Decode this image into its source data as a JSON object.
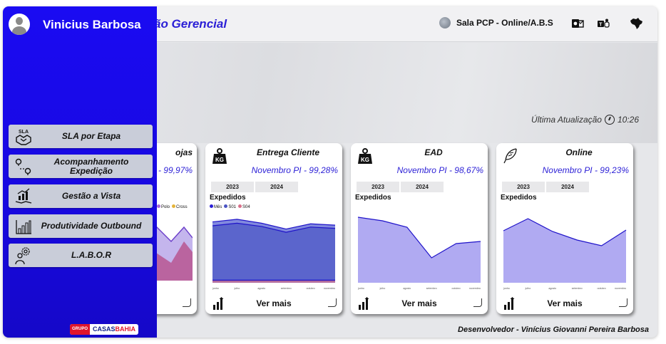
{
  "header": {
    "title": "ão Gerencial",
    "status": "Sala PCP - Online/A.B.S",
    "icons": [
      "brain-icon",
      "outlook-icon",
      "teams-icon",
      "brazil-map-icon"
    ]
  },
  "last_update": {
    "label": "Última Atualização",
    "time": "10:26"
  },
  "sidebar": {
    "user": "Vinicius Barbosa",
    "items": [
      {
        "label": "SLA por Etapa",
        "icon": "sla-handshake-icon"
      },
      {
        "label": "Acompanhamento Expedição",
        "icon": "route-pin-icon"
      },
      {
        "label": "Gestão a Vista",
        "icon": "growth-hands-icon"
      },
      {
        "label": "Produtividade Outbound",
        "icon": "bar-chart-icon"
      },
      {
        "label": "L.A.B.O.R",
        "icon": "worker-gear-icon"
      }
    ],
    "brand": {
      "grupo": "GRUPO",
      "casas": "CASAS",
      "bahia": "BAHIA"
    }
  },
  "cards": [
    {
      "title": "ojas",
      "month_text": "- 99,97%",
      "legend": [
        "Polo",
        "Cross"
      ],
      "more": ""
    },
    {
      "title": "Entrega Cliente",
      "month_text": "Novembro PI - 99,28%",
      "years": [
        "2023",
        "2024"
      ],
      "subtitle": "Expedidos",
      "legend": [
        "Mês",
        "S01",
        "S04"
      ],
      "more": "Ver mais"
    },
    {
      "title": "EAD",
      "month_text": "Novembro PI - 98,67%",
      "years": [
        "2023",
        "2024"
      ],
      "subtitle": "Expedidos",
      "more": "Ver mais"
    },
    {
      "title": "Online",
      "month_text": "Novembro PI - 99,23%",
      "years": [
        "2023",
        "2024"
      ],
      "subtitle": "Expedidos",
      "more": "Ver mais"
    }
  ],
  "chart_data": [
    {
      "type": "area",
      "title": "Expedidos",
      "categories": [
        "junho",
        "julho",
        "agosto",
        "setembro",
        "outubro",
        "novembro"
      ],
      "series": [
        {
          "name": "Mês",
          "values": [
            94,
            98,
            92,
            83,
            91,
            89
          ]
        },
        {
          "name": "S01",
          "values": [
            88,
            92,
            87,
            78,
            86,
            84
          ]
        },
        {
          "name": "S04",
          "values": [
            4,
            4,
            4,
            4,
            4,
            4
          ]
        }
      ],
      "ylim": [
        0,
        110
      ],
      "colors": [
        "#6b74d8",
        "#4b55c4",
        "#d9708a"
      ]
    },
    {
      "type": "area",
      "title": "Expedidos",
      "categories": [
        "junho",
        "julho",
        "agosto",
        "setembro",
        "outubro",
        "novembro"
      ],
      "series": [
        {
          "name": "",
          "values": [
            92,
            87,
            78,
            35,
            55,
            58
          ]
        }
      ],
      "ylim": [
        0,
        100
      ],
      "colors": [
        "#a29bf0"
      ]
    },
    {
      "type": "area",
      "title": "Expedidos",
      "categories": [
        "junho",
        "julho",
        "agosto",
        "setembro",
        "outubro",
        "novembro"
      ],
      "series": [
        {
          "name": "",
          "values": [
            73,
            90,
            72,
            60,
            52,
            74
          ]
        }
      ],
      "ylim": [
        0,
        100
      ],
      "colors": [
        "#a29bf0"
      ]
    }
  ],
  "footer": {
    "developer": "Desenvolvedor - Vinícius Giovanni Pereira Barbosa"
  }
}
